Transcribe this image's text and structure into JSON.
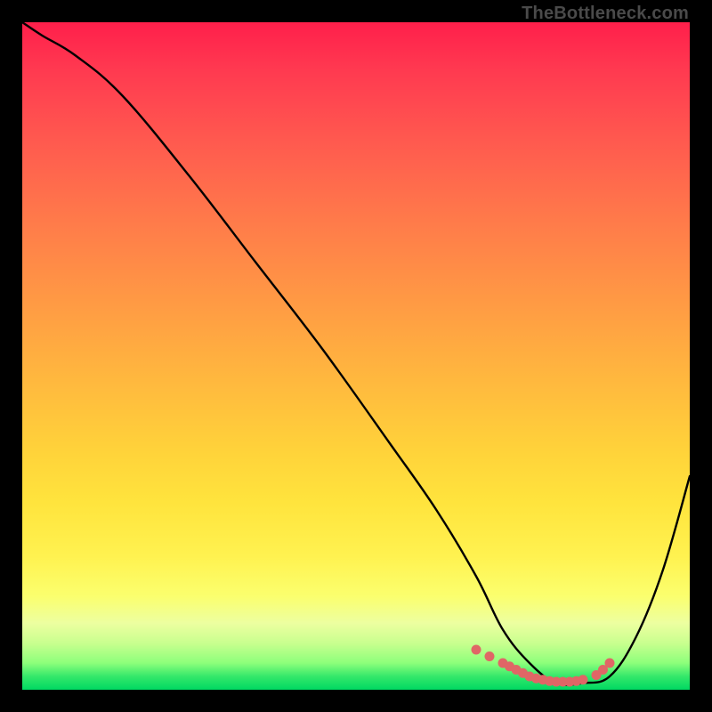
{
  "watermark": "TheBottleneck.com",
  "chart_data": {
    "type": "line",
    "title": "",
    "xlabel": "",
    "ylabel": "",
    "xlim": [
      0,
      100
    ],
    "ylim": [
      0,
      100
    ],
    "grid": false,
    "legend": false,
    "series": [
      {
        "name": "curve",
        "x": [
          0,
          3,
          8,
          15,
          25,
          35,
          45,
          55,
          62,
          68,
          72,
          76,
          80,
          84,
          88,
          92,
          96,
          100
        ],
        "y": [
          100,
          98,
          95,
          89,
          77,
          64,
          51,
          37,
          27,
          17,
          9,
          4,
          1,
          1,
          2,
          8,
          18,
          32
        ]
      }
    ],
    "marker_region": {
      "name": "minimum-dots",
      "x": [
        68,
        70,
        72,
        73,
        74,
        75,
        76,
        77,
        78,
        79,
        80,
        81,
        82,
        83,
        84,
        86,
        87,
        88
      ],
      "y": [
        6,
        5,
        4,
        3.5,
        3,
        2.5,
        2,
        1.7,
        1.5,
        1.3,
        1.2,
        1.2,
        1.2,
        1.3,
        1.5,
        2.2,
        3,
        4
      ]
    },
    "colors": {
      "curve": "#000000",
      "markers": "#e06666",
      "gradient_top": "#ff1f4b",
      "gradient_mid": "#ffe43d",
      "gradient_bottom": "#00d862",
      "frame": "#000000"
    }
  }
}
